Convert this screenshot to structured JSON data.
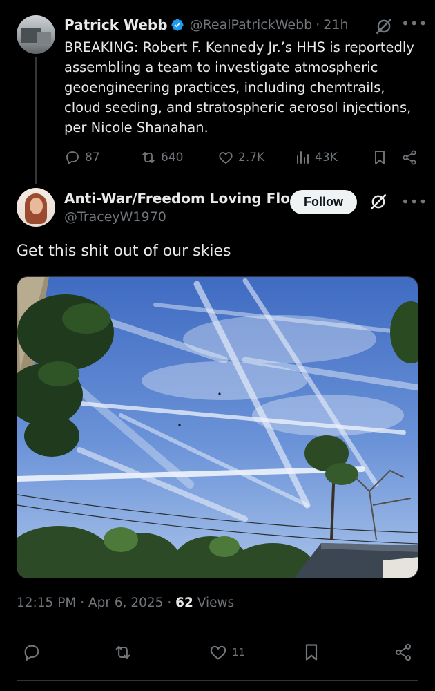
{
  "parent_tweet": {
    "display_name": "Patrick Webb",
    "handle": "@RealPatrickWebb",
    "separator": "·",
    "time": "21h",
    "text": "BREAKING: Robert F. Kennedy Jr.’s HHS is reportedly assembling a team to investigate atmospheric geoengineering practices, including chemtrails, cloud seeding, and stratospheric aerosol injections, per Nicole Shanahan.",
    "replies": "87",
    "reposts": "640",
    "likes": "2.7K",
    "views": "43K"
  },
  "reply_tweet": {
    "display_name": "Anti-War/Freedom Loving Flo...",
    "handle": "@TraceyW1970",
    "follow_label": "Follow",
    "text": "Get this shit out of our skies",
    "timestamp": "12:15 PM · Apr 6, 2025 · ",
    "views_count": "62",
    "views_label": " Views",
    "likes": "11"
  },
  "icons": {
    "verified": "verified-badge-icon",
    "grok": "grok-icon",
    "more": "more-icon",
    "reply": "reply-icon",
    "repost": "repost-icon",
    "like": "heart-icon",
    "views": "analytics-icon",
    "bookmark": "bookmark-icon",
    "share": "share-icon"
  },
  "colors": {
    "background": "#000000",
    "text": "#e7e9ea",
    "muted": "#71767b",
    "verified": "#1d9bf0",
    "follow_bg": "#eff3f4"
  }
}
